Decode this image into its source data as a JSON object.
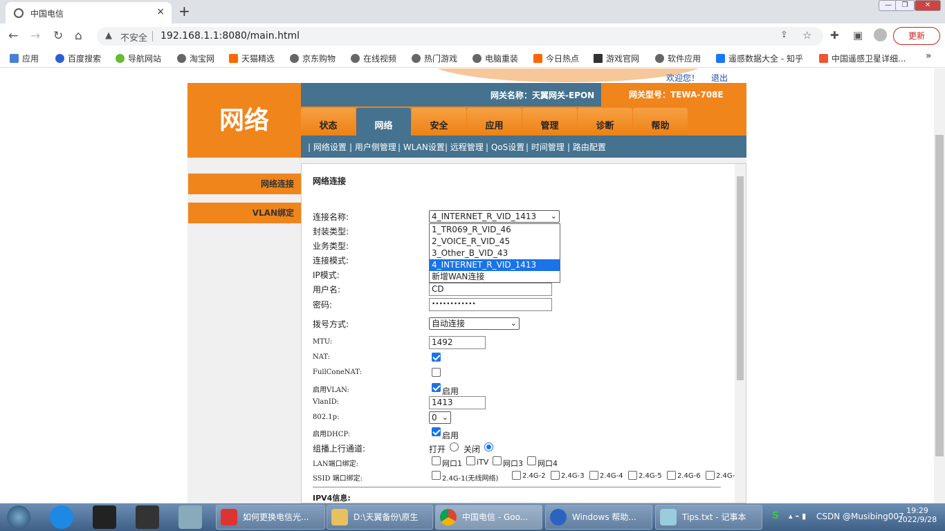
{
  "browser": {
    "tab_title": "中国电信",
    "url": "192.168.1.1:8080/main.html",
    "not_secure": "不安全",
    "update_label": "更新",
    "close_glyph": "×",
    "new_tab_glyph": "+"
  },
  "bookmarks": [
    "应用",
    "百度搜索",
    "导航网站",
    "淘宝网",
    "天猫精选",
    "京东购物",
    "在线视频",
    "热门游戏",
    "电脑重装",
    "今日热点",
    "游戏官网",
    "软件应用",
    "遥感数据大全 - 知乎",
    "中国遥感卫星详细..."
  ],
  "bookmarks_more": "»",
  "gateway": {
    "logo": "网络",
    "welcome": "欢迎您！",
    "logout": "退出",
    "name": "网关名称：天翼网关-EPON",
    "model": "网关型号：TEWA-708E",
    "main_tabs": [
      "状态",
      "网络",
      "安全",
      "应用",
      "管理",
      "诊断",
      "帮助"
    ],
    "active_tab": "网络",
    "sub_tabs": [
      "网络设置",
      "用户侧管理",
      "WLAN设置",
      "远程管理",
      "QoS设置",
      "时间管理",
      "路由配置"
    ],
    "left_menu": [
      "网络连接",
      "VLAN绑定"
    ]
  },
  "form": {
    "section_title": "网络连接",
    "labels": {
      "conn_name": "连接名称:",
      "encap": "封装类型:",
      "service": "业务类型:",
      "conn_mode": "连接模式:",
      "ip_mode": "IP模式:",
      "username": "用户名:",
      "password": "密码:",
      "dial": "拨号方式:",
      "mtu": "MTU:",
      "nat": "NAT:",
      "fullcone": "FullConeNAT:",
      "vlan_enable": "启用VLAN:",
      "vlanid": "VlanID:",
      "p8021": "802.1p:",
      "dhcp_enable": "启用DHCP:",
      "multicast": "组播上行通道:",
      "lan_bind": "LAN端口绑定:",
      "ssid_bind": "SSID 端口绑定:",
      "ipv4": "IPV4信息:"
    },
    "conn_name_value": "4_INTERNET_R_VID_1413",
    "conn_options": [
      "1_TR069_R_VID_46",
      "2_VOICE_R_VID_45",
      "3_Other_B_VID_43",
      "4_INTERNET_R_VID_1413",
      "新增WAN连接"
    ],
    "username_value": "CD",
    "password_mask": "••••••••••••",
    "dial_value": "自动连接",
    "mtu_value": "1492",
    "nat_checked": true,
    "fullcone_checked": false,
    "vlan_checked": true,
    "enable_text": "启用",
    "vlanid_value": "1413",
    "p8021_value": "0",
    "dhcp_checked": true,
    "multicast_open": "打开",
    "multicast_close": "关闭",
    "lan_ports": [
      "网口1",
      "iTV",
      "网口3",
      "网口4"
    ],
    "ssid_ports": [
      "2.4G-1(无线网络)",
      "2.4G-2",
      "2.4G-3",
      "2.4G-4",
      "2.4G-5",
      "2.4G-6",
      "2.4G-"
    ]
  },
  "taskbar": {
    "buttons": [
      "如何更换电信光...",
      "D:\\天翼备份\\原生",
      "中国电信 - Goo...",
      "Windows 帮助...",
      "Tips.txt - 记事本"
    ],
    "tray": "CSDN @Musibing007",
    "time": "19:29",
    "date": "2022/9/28"
  }
}
